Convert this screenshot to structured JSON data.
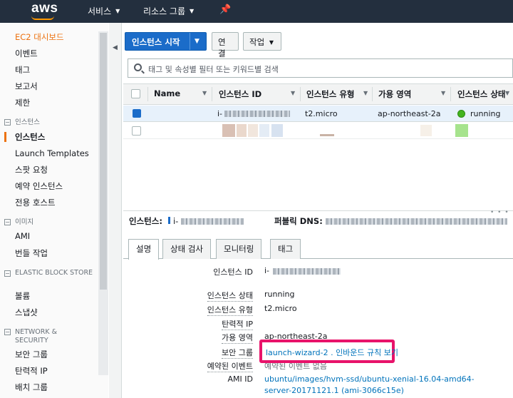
{
  "topbar": {
    "logo": "aws",
    "nav": [
      {
        "label": "서비스"
      },
      {
        "label": "리소스 그룹"
      }
    ],
    "pin_icon": "pushpin-icon"
  },
  "sidebar": {
    "dashboard": "EC2 대시보드",
    "items_top": [
      "이벤트",
      "태그",
      "보고서",
      "제한"
    ],
    "section_instances": {
      "title": "인스턴스",
      "items": [
        "인스턴스",
        "Launch Templates",
        "스팟 요청",
        "예약 인스턴스",
        "전용 호스트"
      ]
    },
    "section_images": {
      "title": "이미지",
      "items": [
        "AMI",
        "번들 작업"
      ]
    },
    "section_ebs": {
      "title": "ELASTIC BLOCK STORE",
      "items": [
        "볼륨",
        "스냅샷"
      ]
    },
    "section_network": {
      "title": "NETWORK & SECURITY",
      "items": [
        "보안 그룹",
        "탄력적 IP",
        "배치 그룹"
      ]
    }
  },
  "toolbar": {
    "launch_label": "인스턴스 시작",
    "connect_label": "연결",
    "actions_label": "작업"
  },
  "search": {
    "placeholder": "태그 및 속성별 필터 또는 키워드별 검색"
  },
  "table": {
    "columns": [
      "Name",
      "인스턴스 ID",
      "인스턴스 유형",
      "가용 영역",
      "인스턴스 상태"
    ],
    "rows": [
      {
        "name": "",
        "id": "i-",
        "type": "t2.micro",
        "az": "ap-northeast-2a",
        "state": "running",
        "selected": true
      }
    ]
  },
  "details": {
    "instance_label": "인스턴스:",
    "instance_value": "i-",
    "dns_label": "퍼블릭 DNS:",
    "tabs": [
      "설명",
      "상태 검사",
      "모니터링",
      "태그"
    ],
    "fields": [
      {
        "label": "인스턴스 ID",
        "value": "i-"
      },
      {
        "label": "인스턴스 상태",
        "value": "running"
      },
      {
        "label": "인스턴스 유형",
        "value": "t2.micro"
      },
      {
        "label": "탄력적 IP",
        "value": ""
      },
      {
        "label": "가용 영역",
        "value": "ap-northeast-2a"
      },
      {
        "label": "보안 그룹",
        "value": "launch-wizard-2 . 인바운드 규칙 보기"
      },
      {
        "label": "예약된 이벤트",
        "value": "예약된 이벤트 없음"
      },
      {
        "label": "AMI ID",
        "value": "ubuntu/images/hvm-ssd/ubuntu-xenial-16.04-amd64-",
        "value2": "server-20171121.1 (ami-3066c15e)"
      }
    ]
  },
  "colors": {
    "topbar": "#232f3e",
    "accent": "#ec7211",
    "primary_button": "#1b6cc9",
    "running": "#43b31f",
    "highlight": "#e8136a",
    "link": "#0073bb"
  }
}
